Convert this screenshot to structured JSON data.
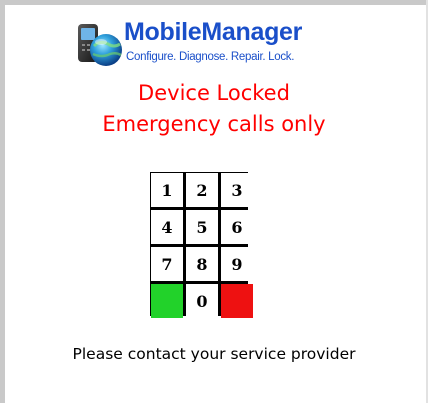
{
  "app": {
    "name": "MobileManager",
    "tagline": "Configure. Diagnose. Repair. Lock."
  },
  "status": {
    "line1": "Device Locked",
    "line2": "Emergency calls only"
  },
  "keypad": {
    "keys": [
      "1",
      "2",
      "3",
      "4",
      "5",
      "6",
      "7",
      "8",
      "9",
      "",
      "0",
      ""
    ],
    "call_key_color": "#22d22a",
    "end_key_color": "#ee1111"
  },
  "message": "Please contact your service provider",
  "colors": {
    "brand": "#1a4fc9",
    "alert": "#ff0000"
  },
  "icons": {
    "logo": "phone-with-globe-icon"
  }
}
